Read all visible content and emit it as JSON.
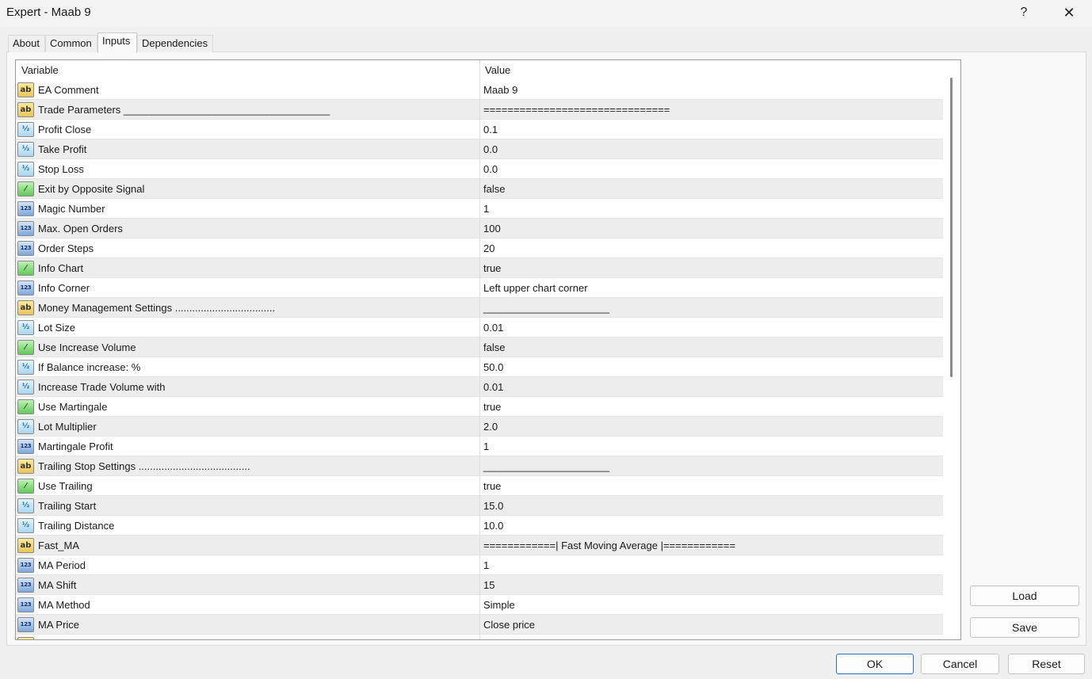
{
  "window": {
    "title": "Expert - Maab 9",
    "help_label": "?",
    "close_label": "✕"
  },
  "tabs": [
    {
      "label": "About"
    },
    {
      "label": "Common"
    },
    {
      "label": "Inputs",
      "active": true
    },
    {
      "label": "Dependencies"
    }
  ],
  "grid": {
    "columns": [
      "Variable",
      "Value"
    ],
    "rows": [
      {
        "type": "string",
        "name": "EA Comment",
        "value": "Maab 9"
      },
      {
        "type": "string",
        "name": "Trade Parameters ____________________________________",
        "value": "==============================="
      },
      {
        "type": "double",
        "name": "Profit Close",
        "value": "0.1"
      },
      {
        "type": "double",
        "name": "Take Profit",
        "value": "0.0"
      },
      {
        "type": "double",
        "name": "Stop Loss",
        "value": "0.0"
      },
      {
        "type": "bool",
        "name": "Exit by Opposite Signal",
        "value": "false"
      },
      {
        "type": "int",
        "name": "Magic Number",
        "value": "1"
      },
      {
        "type": "int",
        "name": "Max. Open Orders",
        "value": "100"
      },
      {
        "type": "int",
        "name": "Order Steps",
        "value": "20"
      },
      {
        "type": "bool",
        "name": "Info Chart",
        "value": "true"
      },
      {
        "type": "int",
        "name": "Info Corner",
        "value": "Left upper chart corner"
      },
      {
        "type": "string",
        "name": "Money Management Settings ...................................",
        "value": "______________________"
      },
      {
        "type": "double",
        "name": "Lot Size",
        "value": "0.01"
      },
      {
        "type": "bool",
        "name": "Use Increase Volume",
        "value": "false"
      },
      {
        "type": "double",
        "name": "If Balance increase: %",
        "value": "50.0"
      },
      {
        "type": "double",
        "name": "Increase Trade Volume with",
        "value": "0.01"
      },
      {
        "type": "bool",
        "name": "Use Martingale",
        "value": "true"
      },
      {
        "type": "double",
        "name": "Lot Multiplier",
        "value": "2.0"
      },
      {
        "type": "int",
        "name": "Martingale Profit",
        "value": "1"
      },
      {
        "type": "string",
        "name": "Trailing Stop Settings .......................................",
        "value": "______________________"
      },
      {
        "type": "bool",
        "name": "Use Trailing",
        "value": "true"
      },
      {
        "type": "double",
        "name": "Trailing Start",
        "value": "15.0"
      },
      {
        "type": "double",
        "name": "Trailing Distance",
        "value": "10.0"
      },
      {
        "type": "string",
        "name": "Fast_MA",
        "value": "============| Fast Moving Average |============"
      },
      {
        "type": "int",
        "name": "MA Period",
        "value": "1"
      },
      {
        "type": "int",
        "name": "MA Shift",
        "value": "15"
      },
      {
        "type": "int",
        "name": "MA Method",
        "value": "Simple"
      },
      {
        "type": "int",
        "name": "MA Price",
        "value": "Close price"
      },
      {
        "type": "string",
        "name": "",
        "value": ""
      }
    ]
  },
  "icons": {
    "string": {
      "name": "string-type-icon",
      "glyph": "ab"
    },
    "double": {
      "name": "double-type-icon",
      "glyph": "½"
    },
    "bool": {
      "name": "bool-type-icon",
      "glyph": "⁄"
    },
    "int": {
      "name": "int-type-icon",
      "glyph": "123"
    }
  },
  "side_buttons": {
    "load": "Load",
    "save": "Save"
  },
  "footer_buttons": {
    "ok": "OK",
    "cancel": "Cancel",
    "reset": "Reset"
  }
}
